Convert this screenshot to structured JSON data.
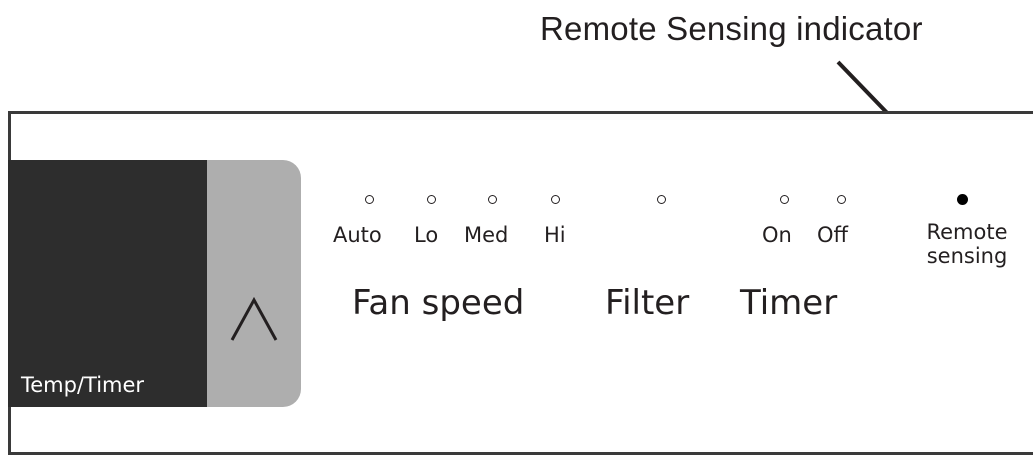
{
  "callout": {
    "text": "Remote Sensing indicator"
  },
  "display": {
    "label": "Temp/Timer"
  },
  "up_button": {
    "icon": "caret-up-icon"
  },
  "fan_speed": {
    "title": "Fan speed",
    "options": [
      {
        "label": "Auto",
        "active": false
      },
      {
        "label": "Lo",
        "active": false
      },
      {
        "label": "Med",
        "active": false
      },
      {
        "label": "Hi",
        "active": false
      }
    ]
  },
  "filter": {
    "title": "Filter",
    "active": false
  },
  "timer": {
    "title": "Timer",
    "options": [
      {
        "label": "On",
        "active": false
      },
      {
        "label": "Off",
        "active": false
      }
    ]
  },
  "remote_sensing": {
    "label_line1": "Remote",
    "label_line2": "sensing",
    "active": true
  },
  "colors": {
    "display_bg": "#2d2d2d",
    "button_bg": "#aeaeae",
    "text": "#231f20",
    "panel_border": "#3a3a3a"
  }
}
